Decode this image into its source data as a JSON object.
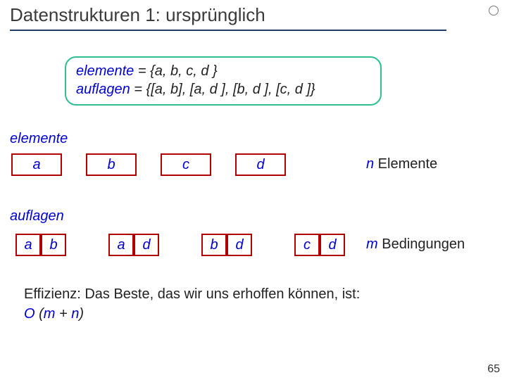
{
  "title": "Datenstrukturen 1: ursprünglich",
  "spec": {
    "elemente_kw": "elemente",
    "elemente_body": " = {a, b, c, d }",
    "auflagen_kw": "auflagen",
    "auflagen_body": " = {[a, b], [a, d ], [b, d ], [c, d ]}"
  },
  "labels": {
    "elemente": "elemente",
    "auflagen": "auflagen"
  },
  "elemente_boxes": [
    "a",
    "b",
    "c",
    "d"
  ],
  "n_elem": {
    "n": "n",
    "txt": " Elemente"
  },
  "auflagen_pairs": [
    [
      "a",
      "b"
    ],
    [
      "a",
      "d"
    ],
    [
      "b",
      "d"
    ],
    [
      "c",
      "d"
    ]
  ],
  "m_bed": {
    "m": "m",
    "txt": " Bedingungen"
  },
  "efficiency": {
    "lead": "Effizienz: Das Beste, das wir uns erhoffen können, ist:",
    "O": "O",
    "open": " (",
    "m": "m",
    "plus": " + ",
    "n": "n",
    "close": ")"
  },
  "pagenum": "65"
}
